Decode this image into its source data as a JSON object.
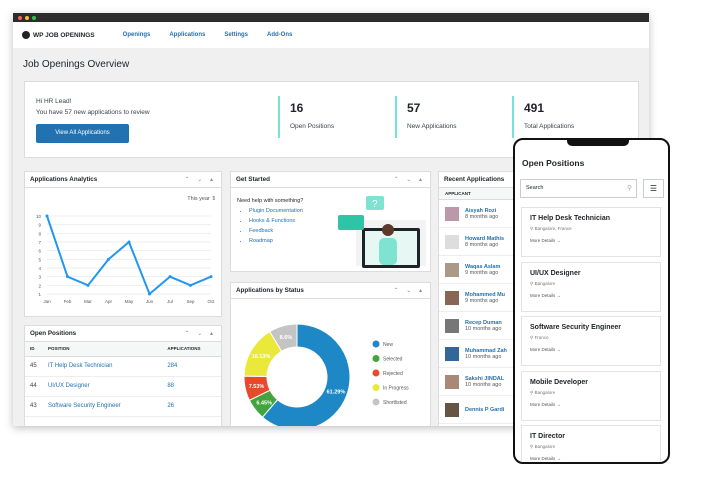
{
  "nav": {
    "brand": "WP JOB OPENINGS",
    "items": [
      "Openings",
      "Applications",
      "Settings",
      "Add-Ons"
    ]
  },
  "page_title": "Job Openings Overview",
  "welcome": {
    "greeting": "Hi HR Lead!",
    "message": "You have 57 new applications to review",
    "button": "View All Applications"
  },
  "stats": [
    {
      "value": "16",
      "label": "Open Positions"
    },
    {
      "value": "57",
      "label": "New Applications"
    },
    {
      "value": "491",
      "label": "Total Applications"
    }
  ],
  "widget_controls": "⌃ ⌄ ▴",
  "analytics": {
    "title": "Applications Analytics",
    "period": "This year",
    "chart_data": {
      "type": "line",
      "categories": [
        "Jan",
        "Feb",
        "Mar",
        "Apr",
        "May",
        "Jun",
        "Jul",
        "Sep",
        "Oct"
      ],
      "values": [
        10,
        3,
        2,
        5,
        7,
        1,
        3,
        2,
        3
      ],
      "ylim": [
        1,
        10
      ],
      "yticks": [
        "1",
        "2",
        "3",
        "4",
        "5",
        "6",
        "7",
        "8",
        "9",
        "10"
      ],
      "grid": true,
      "color": "#2196f3"
    }
  },
  "open_positions": {
    "title": "Open Positions",
    "headers": [
      "ID",
      "POSITION",
      "APPLICATIONS"
    ],
    "rows": [
      [
        "45",
        "IT Help Desk Technician",
        "284"
      ],
      [
        "44",
        "UI/UX Designer",
        "88"
      ],
      [
        "43",
        "Software Security Engineer",
        "26"
      ]
    ]
  },
  "get_started": {
    "title": "Get Started",
    "prompt": "Need help with something?",
    "links": [
      "Plugin Documentation",
      "Hooks & Functions",
      "Feedback",
      "Roadmap"
    ]
  },
  "status": {
    "title": "Applications by Status",
    "chart_data": {
      "type": "pie",
      "labels": [
        "New",
        "Selected",
        "Rejected",
        "In Progress",
        "Shortlisted"
      ],
      "values": [
        61.29,
        6.45,
        7.53,
        16.13,
        8.6
      ],
      "value_labels": [
        "61.29%",
        "6.45%",
        "7.53%",
        "16.13%",
        "8.6%"
      ],
      "colors": [
        "#1e88c7",
        "#43a33f",
        "#e8492b",
        "#ebe83c",
        "#c4c4c4"
      ],
      "legend": "right"
    }
  },
  "recent": {
    "title": "Recent Applications",
    "header": "APPLICANT",
    "items": [
      {
        "name": "Aisyah Rozi",
        "time": "8 months ago"
      },
      {
        "name": "Howard Mathis",
        "time": "8 months ago"
      },
      {
        "name": "Waqas Aslam",
        "time": "9 months ago"
      },
      {
        "name": "Mohammed Mu",
        "time": "9 months ago"
      },
      {
        "name": "Recep Duman",
        "time": "10 months ago"
      },
      {
        "name": "Muhammad Zah",
        "time": "10 months ago"
      },
      {
        "name": "Sakshi JINDAL",
        "time": "10 months ago"
      },
      {
        "name": "Dennis P Gardi",
        "time": ""
      }
    ]
  },
  "phone": {
    "title": "Open Positions",
    "search_placeholder": "Search",
    "more": "More Details →",
    "jobs": [
      {
        "title": "IT Help Desk Technician",
        "location": "Bangalore, France"
      },
      {
        "title": "UI/UX Designer",
        "location": "Bangalore"
      },
      {
        "title": "Software Security Engineer",
        "location": "France"
      },
      {
        "title": "Mobile Developer",
        "location": "Bangalore"
      },
      {
        "title": "IT Director",
        "location": "Bangalore"
      }
    ]
  }
}
